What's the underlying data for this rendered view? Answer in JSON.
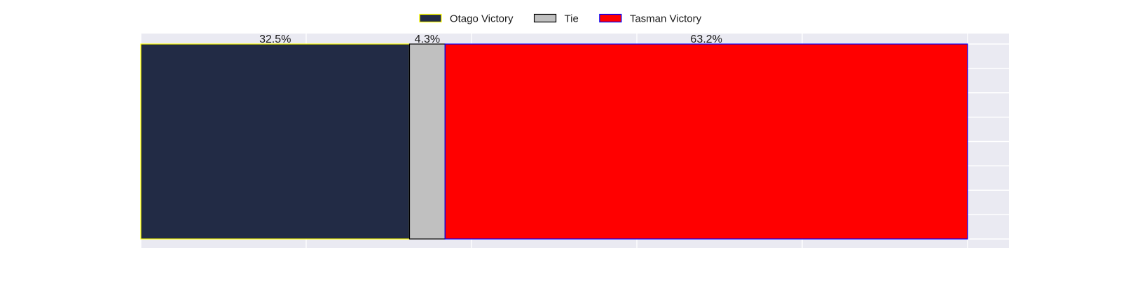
{
  "chart_data": {
    "type": "bar",
    "orientation": "horizontal",
    "stacked": true,
    "categories": [
      ""
    ],
    "series": [
      {
        "name": "Otago Victory",
        "values": [
          32.5
        ],
        "label": "32.5%",
        "color": "#222b45",
        "edgecolor": "#ffff00"
      },
      {
        "name": "Tie",
        "values": [
          4.3
        ],
        "label": "4.3%",
        "color": "#c0c0c0",
        "edgecolor": "#000000"
      },
      {
        "name": "Tasman Victory",
        "values": [
          63.2
        ],
        "label": "63.2%",
        "color": "#ff0000",
        "edgecolor": "#0000ff"
      }
    ],
    "xlim": [
      0,
      105
    ],
    "grid": true,
    "grid_x_ticks": [
      0,
      20,
      40,
      60,
      80,
      100
    ],
    "grid_y_lines": 9,
    "legend": {
      "position": "top-center",
      "columns": 3
    },
    "background": "#eaeaf2",
    "title": "",
    "xlabel": "",
    "ylabel": ""
  }
}
